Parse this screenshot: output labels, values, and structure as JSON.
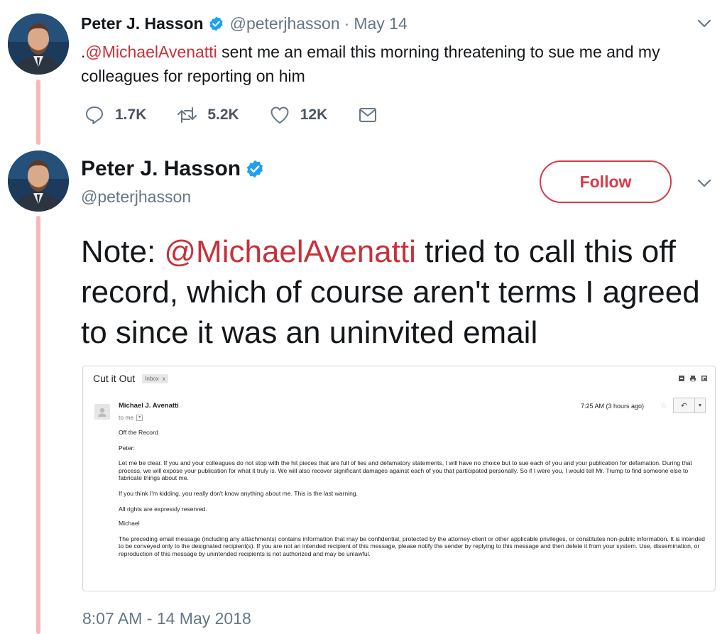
{
  "tweet1": {
    "author_name": "Peter J. Hasson",
    "handle": "@peterjhasson",
    "separator": "·",
    "date": "May 14",
    "text_prefix": ".",
    "mention": "@MichaelAvenatti",
    "text_rest": " sent me an email this morning threatening to sue me and my colleagues for reporting on him",
    "actions": {
      "reply_count": "1.7K",
      "retweet_count": "5.2K",
      "like_count": "12K"
    }
  },
  "tweet2": {
    "author_name": "Peter J. Hasson",
    "handle": "@peterjhasson",
    "follow_label": "Follow",
    "text_prefix": "Note: ",
    "mention": "@MichaelAvenatti",
    "text_rest": " tried to call this off record, which of course aren't terms I agreed to since it was an uninvited email",
    "timestamp": "8:07 AM - 14 May 2018"
  },
  "email": {
    "subject": "Cut it Out",
    "tag": "Inbox",
    "tag_close": "x",
    "from": "Michael J. Avenatti",
    "to": "to me",
    "time": "7:25 AM (3 hours ago)",
    "body": [
      "Off the Record",
      "Peter:",
      "Let me be clear. If you and your colleagues do not stop with the hit pieces that are full of lies and defamatory statements, I will have no choice but to sue each of you and your publication for defamation. During that process, we will expose your publication for what it truly is. We will also recover significant damages against each of you that participated personally.  So if I were you, I would tell Mr. Trump to find someone else to fabricate things about me.",
      "If you think I'm kidding, you really don't know anything about me.  This is the last warning.",
      "All rights are expressly reserved.",
      "Michael",
      "The preceding email message (including any attachments) contains information that may be confidential, protected by the attorney-client or other applicable privileges, or constitutes non-public information.  It is intended to be conveyed only to the designated recipient(s). If you are not an intended recipient of this message, please notify the sender by replying to this message and then delete it from your system.  Use, dissemination, or reproduction of this message by unintended recipients is not authorized and may be unlawful."
    ]
  },
  "colors": {
    "mention": "#c8313a",
    "follow": "#d93a48",
    "thread_line": "#f4b9bd",
    "verified": "#1da1f2",
    "muted": "#657786"
  },
  "icons": [
    "verified-badge-icon",
    "chevron-down-icon",
    "reply-icon",
    "retweet-icon",
    "like-icon",
    "direct-message-icon"
  ]
}
